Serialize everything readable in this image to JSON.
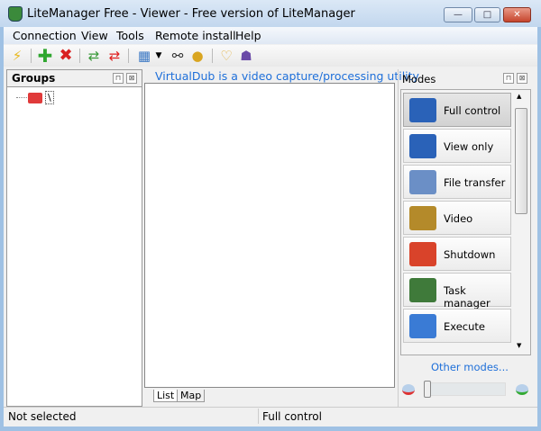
{
  "window": {
    "title": "LiteManager Free - Viewer - Free version of LiteManager",
    "min": "—",
    "max": "□",
    "close": "✕"
  },
  "menu": [
    "Connection",
    "View",
    "Tools",
    "Remote install",
    "Help"
  ],
  "toolbar": {
    "icons": [
      "lightning-icon",
      "add-icon",
      "delete-icon",
      "refresh-green-icon",
      "refresh-red-icon",
      "view-grid-icon",
      "dropdown-icon",
      "binoculars-icon",
      "lock-icon",
      "chat-icon",
      "network-icon"
    ]
  },
  "groups": {
    "title": "Groups",
    "pin": "⊓",
    "close": "⊠",
    "root": "\\"
  },
  "center": {
    "banner": "VirtualDub is a video capture/processing utility",
    "tabs": [
      "List",
      "Map"
    ]
  },
  "modes": {
    "title": "Modes",
    "items": [
      {
        "label": "Full control",
        "selected": true,
        "color": "#2a62b8"
      },
      {
        "label": "View only",
        "color": "#2a62b8"
      },
      {
        "label": "File transfer",
        "color": "#6b8fc6"
      },
      {
        "label": "Video",
        "color": "#b48a2a"
      },
      {
        "label": "Shutdown",
        "color": "#d9432a"
      },
      {
        "label": "Task manager",
        "color": "#3f7a3a"
      },
      {
        "label": "Execute",
        "color": "#3a7bd5"
      }
    ],
    "other": "Other modes...",
    "zoom_value": 0
  },
  "status": {
    "left": "Not selected",
    "right": "Full control"
  }
}
